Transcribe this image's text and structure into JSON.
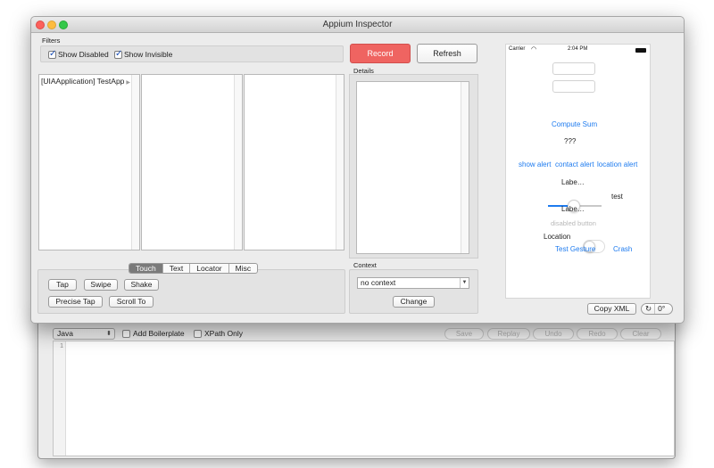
{
  "window": {
    "title": "Appium Inspector"
  },
  "filters": {
    "label": "Filters",
    "show_disabled": "Show Disabled",
    "show_invisible": "Show Invisible"
  },
  "toolbar": {
    "record_label": "Record",
    "refresh_label": "Refresh"
  },
  "tree": {
    "root_item": "[UIAApplication] TestApp"
  },
  "details": {
    "label": "Details"
  },
  "actions": {
    "tabs": [
      "Touch",
      "Text",
      "Locator",
      "Misc"
    ],
    "active_tab": "Touch",
    "tap": "Tap",
    "swipe": "Swipe",
    "shake": "Shake",
    "precise_tap": "Precise Tap",
    "scroll_to": "Scroll To"
  },
  "context": {
    "label": "Context",
    "value": "no context",
    "change": "Change"
  },
  "device": {
    "carrier": "Carrier",
    "wifi_icon": "wifi-icon",
    "time": "2:04 PM",
    "compute_sum": "Compute Sum",
    "result": "???",
    "show_alert": "show alert",
    "contact_alert": "contact alert",
    "location_alert": "location alert",
    "label1": "Labe…",
    "slider_label": "test",
    "slider_value": 0.45,
    "label2": "Labe…",
    "disabled_button": "disabled button",
    "location": "Location",
    "test_gesture": "Test Gesture",
    "crash": "Crash"
  },
  "preview_controls": {
    "copy_xml": "Copy XML",
    "rotate_icon": "rotate-icon",
    "rotation": "0°"
  },
  "editor": {
    "language": "Java",
    "add_boilerplate": "Add Boilerplate",
    "xpath_only": "XPath Only",
    "save": "Save",
    "replay": "Replay",
    "undo": "Undo",
    "redo": "Redo",
    "clear": "Clear",
    "line_numbers": [
      "1"
    ]
  },
  "colors": {
    "record": "#ef6461",
    "link_blue": "#1e7bef",
    "slider_fill": "#1e7bef"
  }
}
